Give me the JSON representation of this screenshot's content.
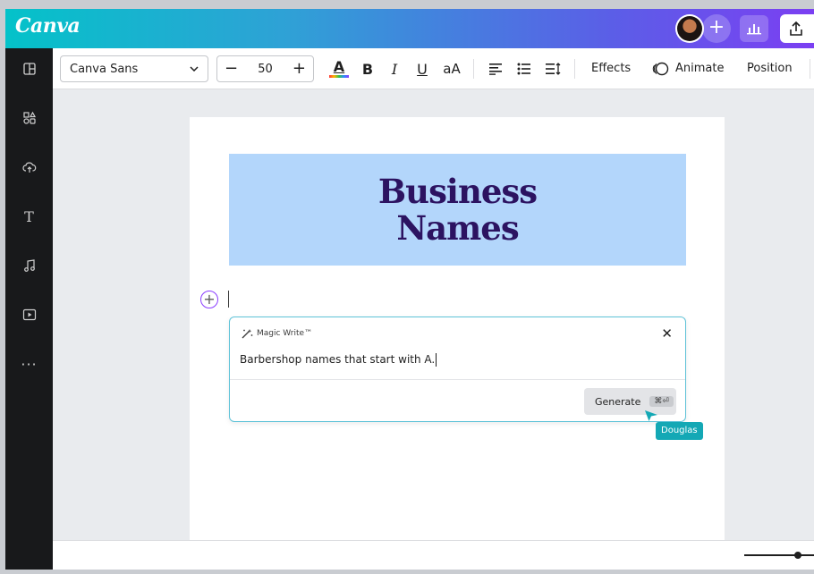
{
  "app": {
    "logo": "Canva"
  },
  "header": {
    "add_collaborator_label": "+"
  },
  "sidebar": {
    "items": [
      {
        "icon": "layout-icon"
      },
      {
        "icon": "elements-icon"
      },
      {
        "icon": "upload-cloud-icon"
      },
      {
        "icon": "text-icon",
        "glyph": "T"
      },
      {
        "icon": "music-icon"
      },
      {
        "icon": "video-icon"
      },
      {
        "icon": "more-icon",
        "glyph": "···"
      }
    ]
  },
  "toolbar": {
    "font_family": "Canva Sans",
    "font_size": "50",
    "decrease_label": "−",
    "increase_label": "+",
    "text_color_glyph": "A",
    "bold_glyph": "B",
    "italic_glyph": "I",
    "underline_glyph": "U",
    "case_glyph": "aA",
    "effects_label": "Effects",
    "animate_label": "Animate",
    "position_label": "Position"
  },
  "canvas": {
    "title_line1": "Business",
    "title_line2": "Names",
    "add_block_label": "+"
  },
  "magic_write": {
    "title": "Magic Write™",
    "close_glyph": "✕",
    "prompt": "Barbershop names that start with A.",
    "generate_label": "Generate",
    "shortcut": "⌘⏎"
  },
  "collaborator": {
    "name": "Douglas"
  },
  "colors": {
    "accent": "#8b3dff",
    "title_bg": "#b3d6fb",
    "title_text": "#2c1361",
    "collaborator": "#14a8b5"
  }
}
